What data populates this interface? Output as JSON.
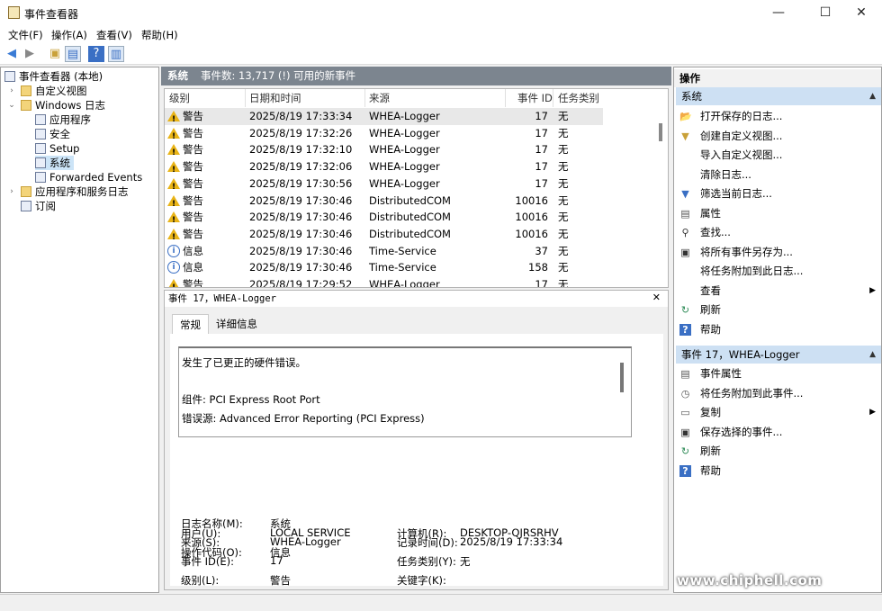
{
  "window": {
    "title": "事件查看器",
    "minimize": "—",
    "maximize": "☐",
    "close": "✕"
  },
  "menu": [
    "文件(F)",
    "操作(A)",
    "查看(V)",
    "帮助(H)"
  ],
  "tree": {
    "root": "事件查看器 (本地)",
    "custom_views": "自定义视图",
    "windows_logs": "Windows 日志",
    "application": "应用程序",
    "security": "安全",
    "setup": "Setup",
    "system": "系统",
    "forwarded": "Forwarded Events",
    "apps_services": "应用程序和服务日志",
    "subscriptions": "订阅"
  },
  "center": {
    "log_name": "系统",
    "event_count": "事件数: 13,717 (!) 可用的新事件",
    "columns": {
      "level": "级别",
      "datetime": "日期和时间",
      "source": "来源",
      "event_id": "事件 ID",
      "task": "任务类别"
    },
    "rows": [
      {
        "type": "warning",
        "level": "警告",
        "datetime": "2025/8/19 17:33:34",
        "source": "WHEA-Logger",
        "event_id": "17",
        "task": "无"
      },
      {
        "type": "warning",
        "level": "警告",
        "datetime": "2025/8/19 17:32:26",
        "source": "WHEA-Logger",
        "event_id": "17",
        "task": "无"
      },
      {
        "type": "warning",
        "level": "警告",
        "datetime": "2025/8/19 17:32:10",
        "source": "WHEA-Logger",
        "event_id": "17",
        "task": "无"
      },
      {
        "type": "warning",
        "level": "警告",
        "datetime": "2025/8/19 17:32:06",
        "source": "WHEA-Logger",
        "event_id": "17",
        "task": "无"
      },
      {
        "type": "warning",
        "level": "警告",
        "datetime": "2025/8/19 17:30:56",
        "source": "WHEA-Logger",
        "event_id": "17",
        "task": "无"
      },
      {
        "type": "warning",
        "level": "警告",
        "datetime": "2025/8/19 17:30:46",
        "source": "DistributedCOM",
        "event_id": "10016",
        "task": "无"
      },
      {
        "type": "warning",
        "level": "警告",
        "datetime": "2025/8/19 17:30:46",
        "source": "DistributedCOM",
        "event_id": "10016",
        "task": "无"
      },
      {
        "type": "warning",
        "level": "警告",
        "datetime": "2025/8/19 17:30:46",
        "source": "DistributedCOM",
        "event_id": "10016",
        "task": "无"
      },
      {
        "type": "info",
        "level": "信息",
        "datetime": "2025/8/19 17:30:46",
        "source": "Time-Service",
        "event_id": "37",
        "task": "无"
      },
      {
        "type": "info",
        "level": "信息",
        "datetime": "2025/8/19 17:30:46",
        "source": "Time-Service",
        "event_id": "158",
        "task": "无"
      },
      {
        "type": "warning",
        "level": "警告",
        "datetime": "2025/8/19 17:29:52",
        "source": "WHEA-Logger",
        "event_id": "17",
        "task": "无"
      }
    ]
  },
  "detail": {
    "header": "事件 17，WHEA-Logger",
    "close": "✕",
    "tabs": [
      "常规",
      "详细信息"
    ],
    "message_line1": "发生了已更正的硬件错误。",
    "message_line2": "组件: PCI Express Root Port",
    "message_line3": "错误源: Advanced Error Reporting (PCI Express)",
    "fields": {
      "log_name_label": "日志名称(M):",
      "log_name_value": "系统",
      "source_label": "来源(S):",
      "source_value": "WHEA-Logger",
      "logged_label": "记录时间(D):",
      "logged_value": "2025/8/19 17:33:34",
      "event_id_label": "事件 ID(E):",
      "event_id_value": "17",
      "task_label": "任务类别(Y):",
      "task_value": "无",
      "level_label": "级别(L):",
      "level_value": "警告",
      "keywords_label": "关键字(K):",
      "user_label": "用户(U):",
      "user_value": "LOCAL SERVICE",
      "computer_label": "计算机(R):",
      "computer_value": "DESKTOP-QJRSRHV",
      "opcode_label": "操作代码(O):",
      "opcode_value": "信息"
    }
  },
  "actions": {
    "title": "操作",
    "section1": "系统",
    "items1": [
      "打开保存的日志...",
      "创建自定义视图...",
      "导入自定义视图...",
      "清除日志...",
      "筛选当前日志...",
      "属性",
      "查找...",
      "将所有事件另存为...",
      "将任务附加到此日志...",
      "查看",
      "刷新",
      "帮助"
    ],
    "section2": "事件 17，WHEA-Logger",
    "items2": [
      "事件属性",
      "将任务附加到此事件...",
      "复制",
      "保存选择的事件...",
      "刷新",
      "帮助"
    ]
  },
  "watermark": {
    "logo": "chip hell",
    "url": "www.chiphell.com"
  }
}
